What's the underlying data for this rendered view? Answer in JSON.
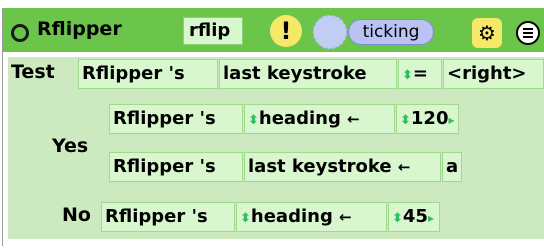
{
  "header": {
    "title": "Rflipper",
    "name_tile": "rflip",
    "status_pill": "ticking",
    "alert_symbol": "!",
    "icons": [
      "radio-icon",
      "alert-icon",
      "tick-dial-icon",
      "ok-icon",
      "menu-icon"
    ]
  },
  "rule": {
    "test_label": "Test",
    "test_expr": {
      "object": "Rflipper 's",
      "property": "last keystroke",
      "operator": "=",
      "value": "<right>"
    },
    "yes_label": "Yes",
    "yes_statements": [
      {
        "object": "Rflipper 's",
        "property": "heading",
        "op": "←",
        "value": "120"
      },
      {
        "object": "Rflipper 's",
        "property": "last keystroke",
        "op": "←",
        "value": "a"
      }
    ],
    "no_label": "No",
    "no_statements": [
      {
        "object": "Rflipper 's",
        "property": "heading",
        "op": "←",
        "value": "45"
      }
    ]
  },
  "colors": {
    "header_green": "#6bc54a",
    "tile_fill": "#d9f7cf",
    "body_fill": "#cde9c0",
    "pill_blue": "#b9c2f2",
    "alert_yellow": "#f6e96a"
  }
}
